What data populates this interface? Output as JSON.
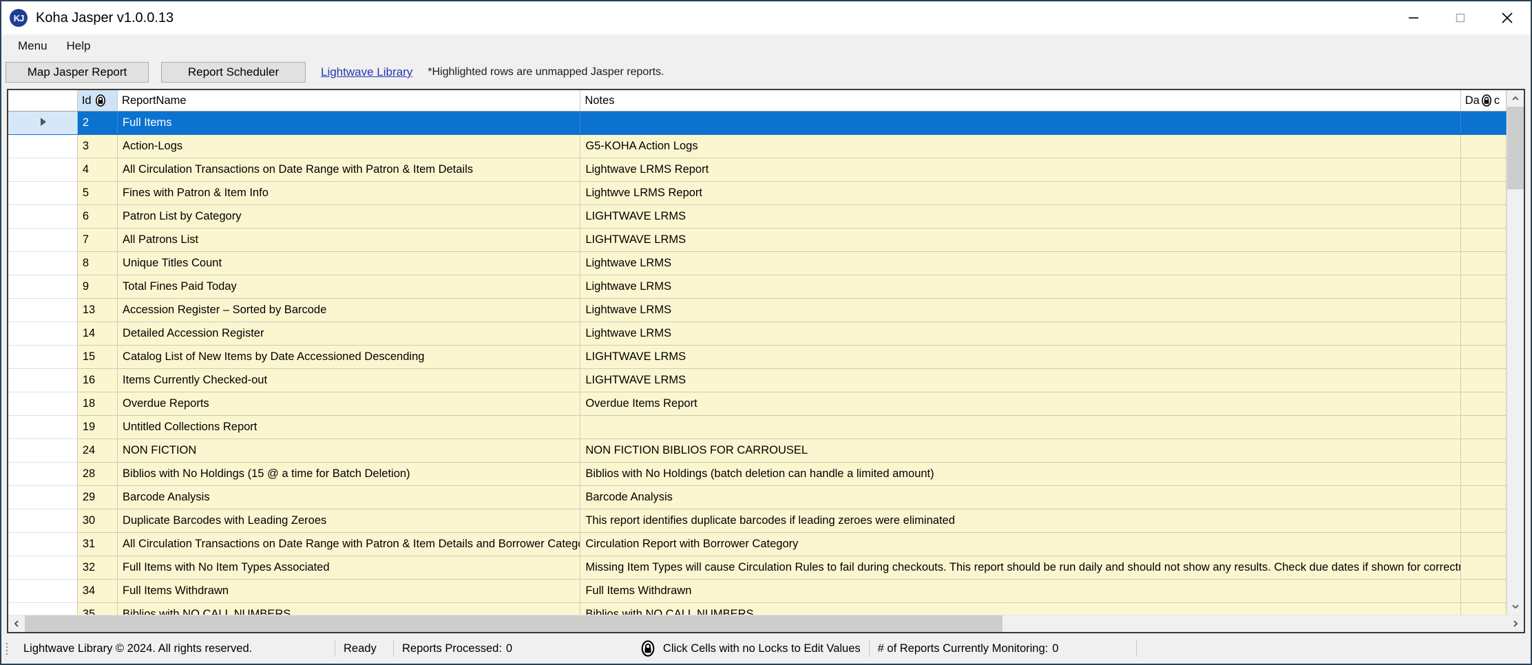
{
  "window": {
    "title": "Koha Jasper v1.0.0.13",
    "icon_label": "KJ",
    "minimize_icon": "minimize-icon",
    "maximize_icon": "maximize-icon",
    "close_icon": "close-icon"
  },
  "menu": {
    "items": [
      {
        "label": "Menu"
      },
      {
        "label": "Help"
      }
    ]
  },
  "toolbar": {
    "map_jasper_report": "Map Jasper Report",
    "report_scheduler": "Report Scheduler",
    "lightwave_library_link": "Lightwave Library",
    "highlight_note": "*Highlighted rows are unmapped Jasper reports.",
    "link_color": "#2437b0"
  },
  "grid": {
    "columns": [
      {
        "key": "selector",
        "label": ""
      },
      {
        "key": "id",
        "label": "Id",
        "locked": true,
        "lock_icon": "lock-icon",
        "header_bg": "#cfe3f7"
      },
      {
        "key": "report_name",
        "label": "ReportName"
      },
      {
        "key": "notes",
        "label": "Notes"
      },
      {
        "key": "date",
        "label": "Da",
        "label_tail": "c",
        "locked": true,
        "lock_icon": "lock-icon"
      }
    ],
    "selection_color": "#0b72d0",
    "row_highlight_color": "#fcf6d0",
    "rows": [
      {
        "id": "2",
        "report_name": "Full Items",
        "notes": "",
        "date": "",
        "selected": true
      },
      {
        "id": "3",
        "report_name": "Action-Logs",
        "notes": "G5-KOHA Action Logs",
        "date": "",
        "selected": false
      },
      {
        "id": "4",
        "report_name": "All Circulation Transactions on Date Range with Patron & Item Details",
        "notes": "Lightwave LRMS Report",
        "date": "",
        "selected": false
      },
      {
        "id": "5",
        "report_name": "Fines with Patron & Item Info",
        "notes": "Lightwve LRMS Report",
        "date": "",
        "selected": false
      },
      {
        "id": "6",
        "report_name": "Patron List by Category",
        "notes": "LIGHTWAVE LRMS",
        "date": "",
        "selected": false
      },
      {
        "id": "7",
        "report_name": "All Patrons List",
        "notes": "LIGHTWAVE LRMS",
        "date": "",
        "selected": false
      },
      {
        "id": "8",
        "report_name": "Unique Titles Count",
        "notes": "Lightwave LRMS",
        "date": "",
        "selected": false
      },
      {
        "id": "9",
        "report_name": "Total Fines Paid Today",
        "notes": "Lightwave LRMS",
        "date": "",
        "selected": false
      },
      {
        "id": "13",
        "report_name": "Accession Register – Sorted by Barcode",
        "notes": "Lightwave LRMS",
        "date": "",
        "selected": false
      },
      {
        "id": "14",
        "report_name": "Detailed Accession Register",
        "notes": "Lightwave LRMS",
        "date": "",
        "selected": false
      },
      {
        "id": "15",
        "report_name": "Catalog List of New Items by Date Accessioned Descending",
        "notes": "LIGHTWAVE LRMS",
        "date": "",
        "selected": false
      },
      {
        "id": "16",
        "report_name": "Items Currently Checked-out",
        "notes": "LIGHTWAVE LRMS",
        "date": "",
        "selected": false
      },
      {
        "id": "18",
        "report_name": "Overdue Reports",
        "notes": "Overdue Items Report",
        "date": "",
        "selected": false
      },
      {
        "id": "19",
        "report_name": "Untitled Collections Report",
        "notes": "",
        "date": "",
        "selected": false
      },
      {
        "id": "24",
        "report_name": "NON FICTION",
        "notes": "NON FICTION BIBLIOS FOR CARROUSEL",
        "date": "",
        "selected": false
      },
      {
        "id": "28",
        "report_name": "Biblios with No Holdings (15 @ a time for Batch Deletion)",
        "notes": "Biblios with No Holdings (batch deletion can handle a limited amount)",
        "date": "",
        "selected": false
      },
      {
        "id": "29",
        "report_name": "Barcode Analysis",
        "notes": "Barcode Analysis",
        "date": "",
        "selected": false
      },
      {
        "id": "30",
        "report_name": "Duplicate Barcodes with Leading Zeroes",
        "notes": "This report identifies duplicate barcodes if leading zeroes were eliminated",
        "date": "",
        "selected": false
      },
      {
        "id": "31",
        "report_name": "All Circulation Transactions on Date Range with Patron & Item Details and Borrower Category",
        "notes": "Circulation Report with Borrower Category",
        "date": "",
        "selected": false
      },
      {
        "id": "32",
        "report_name": "Full Items with No Item Types Associated",
        "notes": "Missing Item Types will cause Circulation Rules to fail during checkouts. This report should be run daily and should not show any results. Check due dates if shown for correctness.",
        "date": "",
        "selected": false
      },
      {
        "id": "34",
        "report_name": "Full Items Withdrawn",
        "notes": "Full Items Withdrawn",
        "date": "",
        "selected": false
      },
      {
        "id": "35",
        "report_name": "Biblios with NO CALL NUMBERS",
        "notes": "Biblios with NO CALL NUMBERS",
        "date": "",
        "selected": false
      }
    ]
  },
  "scrollbars": {
    "vertical_up_icon": "chevron-up-icon",
    "vertical_down_icon": "chevron-down-icon",
    "horizontal_left_icon": "chevron-left-icon",
    "horizontal_right_icon": "chevron-right-icon"
  },
  "status_bar": {
    "copyright": "Lightwave Library © 2024. All rights reserved.",
    "ready": "Ready",
    "reports_processed_label": "Reports Processed:",
    "reports_processed_value": "0",
    "lock_icon": "lock-icon",
    "lock_hint": "Click Cells with no Locks to Edit Values",
    "monitoring_label": "# of Reports Currently Monitoring:",
    "monitoring_value": "0"
  }
}
